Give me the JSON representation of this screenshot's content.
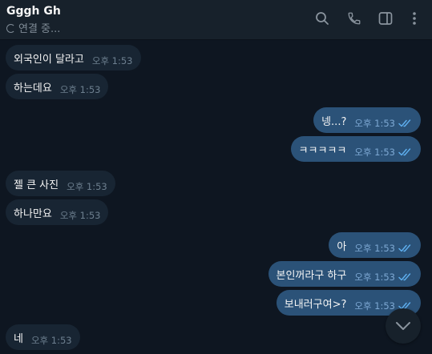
{
  "header": {
    "name": "Gggh Gh",
    "status": "연결 중..."
  },
  "messages": [
    {
      "dir": "in",
      "text": "외국인이 달라고",
      "time": "오후 1:53"
    },
    {
      "dir": "in",
      "text": "하는데요",
      "time": "오후 1:53"
    },
    {
      "dir": "out",
      "text": "넹...?",
      "time": "오후 1:53"
    },
    {
      "dir": "out",
      "text": "ㅋㅋㅋㅋㅋ",
      "time": "오후 1:53"
    },
    {
      "dir": "in",
      "text": "젤 큰 사진",
      "time": "오후 1:53"
    },
    {
      "dir": "in",
      "text": "하나만요",
      "time": "오후 1:53"
    },
    {
      "dir": "out",
      "text": "아",
      "time": "오후 1:53"
    },
    {
      "dir": "out",
      "text": "본인꺼라구 하구",
      "time": "오후 1:53"
    },
    {
      "dir": "out",
      "text": "보내러구여>?",
      "time": "오후 1:53"
    },
    {
      "dir": "in",
      "text": "네",
      "time": "오후 1:53"
    }
  ],
  "colors": {
    "background": "#0e1621",
    "header": "#17212b",
    "incoming_bubble": "#182533",
    "outgoing_bubble": "#2b5278",
    "read_check": "#5fb0f0"
  },
  "icons": [
    "search-icon",
    "phone-icon",
    "sidebar-toggle-icon",
    "more-vertical-icon",
    "scroll-down-icon",
    "loading-icon",
    "double-check-icon"
  ]
}
